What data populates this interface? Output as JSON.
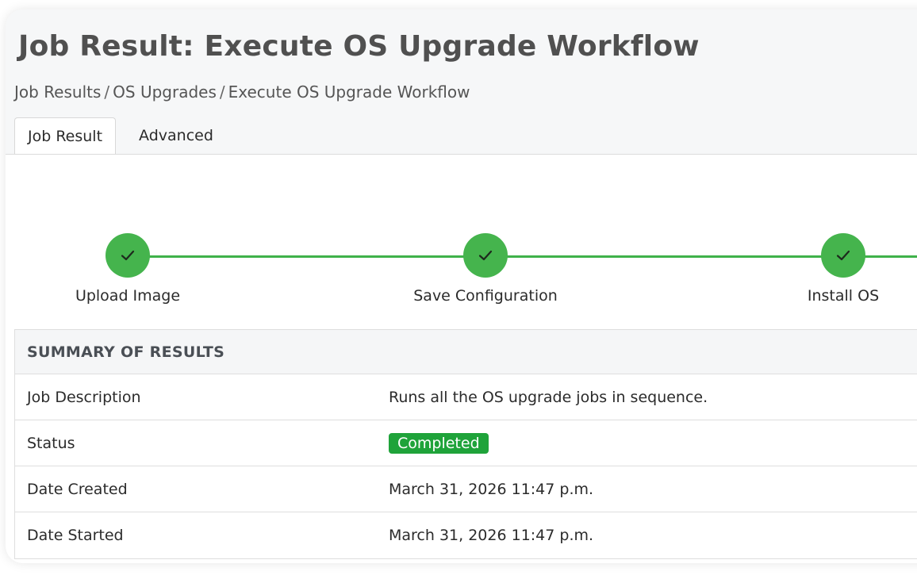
{
  "page": {
    "title": "Job Result: Execute OS Upgrade Workflow"
  },
  "breadcrumb": {
    "items": [
      "Job Results",
      "OS Upgrades",
      "Execute OS Upgrade Workflow"
    ],
    "separator": "/"
  },
  "tabs": [
    {
      "label": "Job Result",
      "active": true
    },
    {
      "label": "Advanced",
      "active": false
    }
  ],
  "workflow": {
    "steps": [
      {
        "label": "Upload Image",
        "status": "complete",
        "icon": "check-icon"
      },
      {
        "label": "Save Configuration",
        "status": "complete",
        "icon": "check-icon"
      },
      {
        "label": "Install OS",
        "status": "complete",
        "icon": "check-icon"
      }
    ],
    "color": "#45b44d"
  },
  "summary": {
    "heading": "SUMMARY OF RESULTS",
    "rows": {
      "description": {
        "key": "Job Description",
        "value": "Runs all the OS upgrade jobs in sequence."
      },
      "status": {
        "key": "Status",
        "value": "Completed",
        "color": "#1fa33a"
      },
      "created": {
        "key": "Date Created",
        "value": "March 31, 2026 11:47 p.m."
      },
      "started": {
        "key": "Date Started",
        "value": "March 31, 2026 11:47 p.m."
      }
    }
  }
}
